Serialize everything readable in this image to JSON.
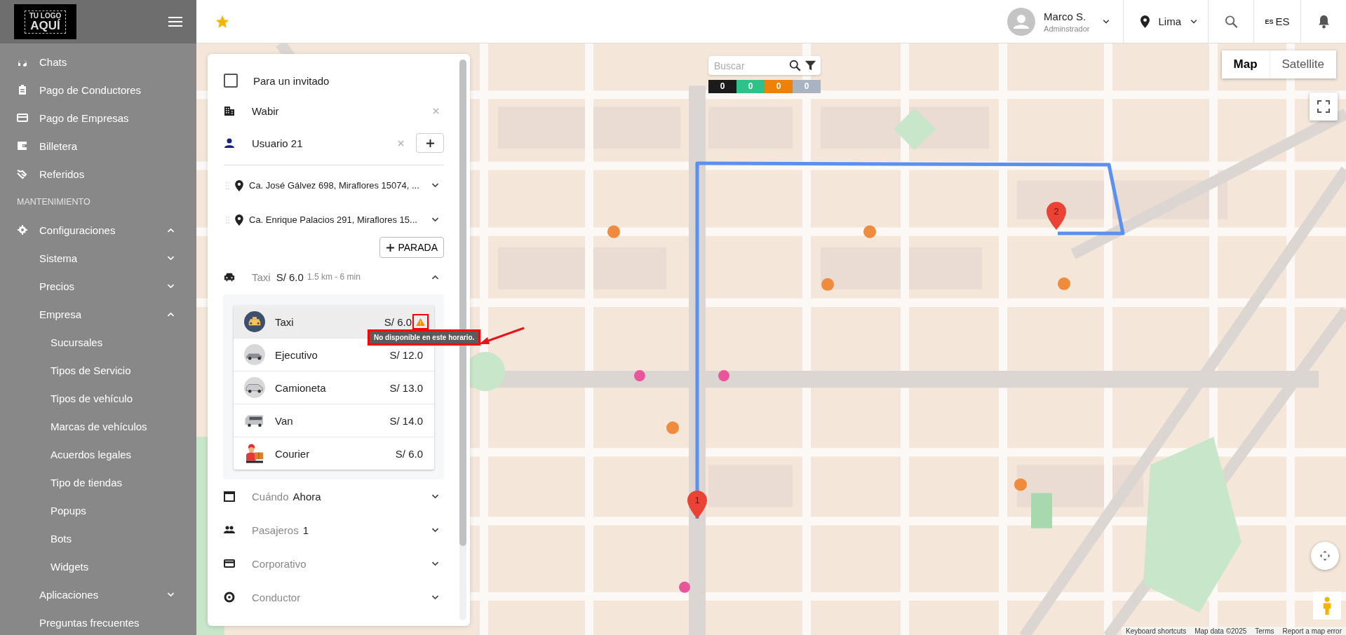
{
  "sidebar": {
    "logo": {
      "line1": "TU LOGO",
      "line2": "AQUÍ"
    },
    "items": [
      {
        "kind": "link",
        "label": "Chats"
      },
      {
        "kind": "link",
        "label": "Pago de Conductores"
      },
      {
        "kind": "link",
        "label": "Pago de Empresas"
      },
      {
        "kind": "link",
        "label": "Billetera"
      },
      {
        "kind": "link",
        "label": "Referidos"
      },
      {
        "kind": "section",
        "label": "MANTENIMIENTO"
      },
      {
        "kind": "link",
        "label": "Configuraciones",
        "expanded": true,
        "children": [
          {
            "label": "Sistema",
            "expanded": false
          },
          {
            "label": "Precios",
            "expanded": false
          },
          {
            "label": "Empresa",
            "expanded": true,
            "children": [
              {
                "label": "Sucursales"
              },
              {
                "label": "Tipos de Servicio"
              },
              {
                "label": "Tipos de vehículo"
              },
              {
                "label": "Marcas de vehículos"
              },
              {
                "label": "Acuerdos legales"
              },
              {
                "label": "Tipo de tiendas"
              },
              {
                "label": "Popups"
              },
              {
                "label": "Bots"
              },
              {
                "label": "Widgets"
              }
            ]
          },
          {
            "label": "Aplicaciones",
            "expanded": false
          },
          {
            "label": "Preguntas frecuentes"
          }
        ]
      }
    ]
  },
  "header": {
    "user": {
      "name": "Marco S.",
      "role": "Adminstrador"
    },
    "city": "Lima",
    "language": {
      "code": "ES",
      "label": "ES"
    }
  },
  "panel": {
    "guest": {
      "label": "Para un invitado",
      "checked": false
    },
    "company": {
      "value": "Wabir"
    },
    "user": {
      "value": "Usuario 21"
    },
    "stops": [
      {
        "address": "Ca. José Gálvez 698, Miraflores 15074, ..."
      },
      {
        "address": "Ca. Enrique Palacios 291, Miraflores 15..."
      }
    ],
    "add_stop": "PARADA",
    "service": {
      "name": "Taxi",
      "price": "S/ 6.0",
      "distance": "1.5 km - 6 min",
      "expanded": true
    },
    "vehicles": [
      {
        "name": "Taxi",
        "price": "S/ 6.0",
        "selected": true,
        "warning": true
      },
      {
        "name": "Ejecutivo",
        "price": "S/ 12.0",
        "selected": false,
        "warning": false
      },
      {
        "name": "Camioneta",
        "price": "S/ 13.0",
        "selected": false,
        "warning": false
      },
      {
        "name": "Van",
        "price": "S/ 14.0",
        "selected": false,
        "warning": false
      },
      {
        "name": "Courier",
        "price": "S/ 6.0",
        "selected": false,
        "warning": false
      }
    ],
    "tooltip": "No disponible en este horario.",
    "options": [
      {
        "label": "Cuándo",
        "value": "Ahora",
        "expanded": false
      },
      {
        "label": "Pasajeros",
        "value": "1",
        "expanded": false
      },
      {
        "label": "Corporativo",
        "expanded": false
      },
      {
        "label": "Conductor",
        "expanded": false
      }
    ]
  },
  "map": {
    "search": {
      "placeholder": "Buscar"
    },
    "counters": [
      {
        "value": "0",
        "color": "#1b1b1b"
      },
      {
        "value": "0",
        "color": "#2ec28a"
      },
      {
        "value": "0",
        "color": "#ee8208"
      },
      {
        "value": "0",
        "color": "#a9b4c2"
      }
    ],
    "map_types": [
      {
        "label": "Map",
        "selected": true
      },
      {
        "label": "Satellite",
        "selected": false
      }
    ],
    "markers": [
      {
        "label": "1"
      },
      {
        "label": "2"
      }
    ],
    "attribution": [
      "Keyboard shortcuts",
      "Map data ©2025",
      "Terms",
      "Report a map error"
    ]
  }
}
